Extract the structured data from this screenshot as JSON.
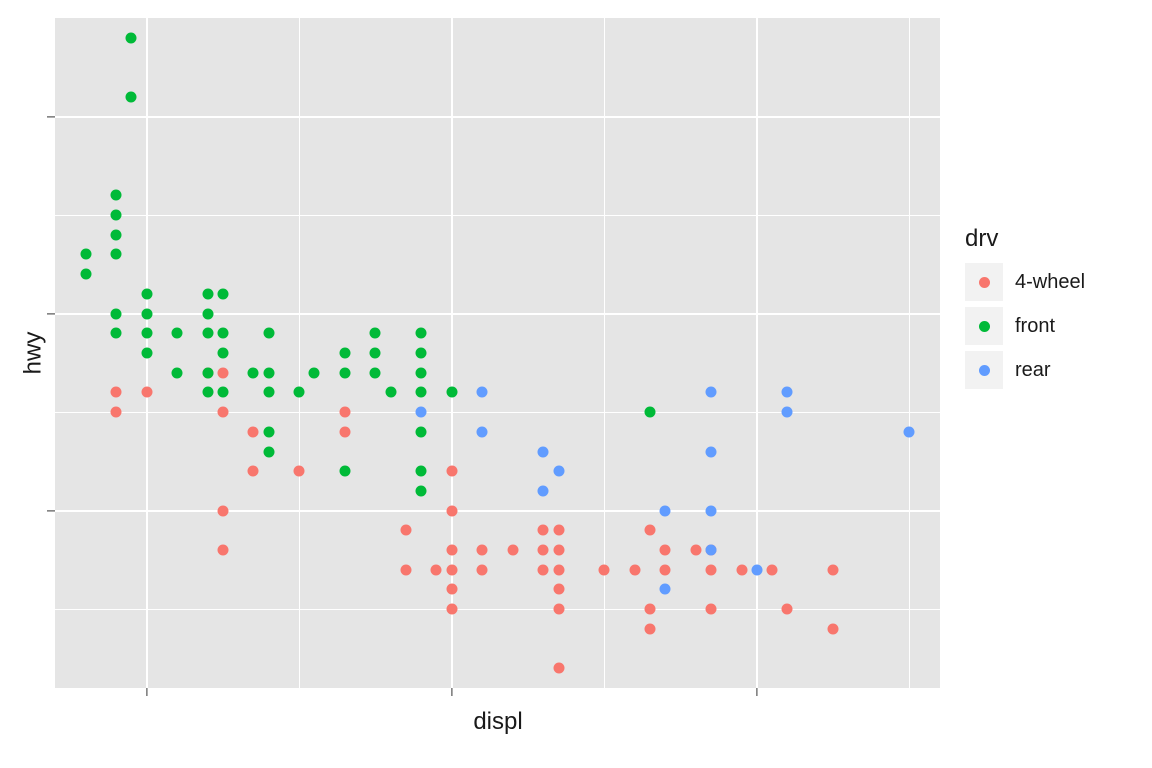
{
  "chart_data": {
    "type": "scatter",
    "xlabel": "displ",
    "ylabel": "hwy",
    "xlim": [
      1.4,
      7.2
    ],
    "ylim": [
      11,
      45
    ],
    "x_major_ticks": [
      2,
      4,
      6
    ],
    "x_minor_ticks": [
      3,
      5,
      7
    ],
    "y_major_ticks": [
      20,
      30,
      40
    ],
    "y_minor_ticks": [
      15,
      25,
      35
    ],
    "legend_title": "drv",
    "series": [
      {
        "name": "4-wheel",
        "color": "#F8766D",
        "points": [
          {
            "x": 1.8,
            "y": 26
          },
          {
            "x": 1.8,
            "y": 25
          },
          {
            "x": 2.0,
            "y": 26
          },
          {
            "x": 2.4,
            "y": 27
          },
          {
            "x": 2.5,
            "y": 25
          },
          {
            "x": 2.5,
            "y": 27
          },
          {
            "x": 2.5,
            "y": 20
          },
          {
            "x": 2.5,
            "y": 18
          },
          {
            "x": 2.7,
            "y": 24
          },
          {
            "x": 2.7,
            "y": 22
          },
          {
            "x": 3.0,
            "y": 22
          },
          {
            "x": 3.3,
            "y": 25
          },
          {
            "x": 3.3,
            "y": 24
          },
          {
            "x": 3.7,
            "y": 19
          },
          {
            "x": 3.7,
            "y": 17
          },
          {
            "x": 3.9,
            "y": 17
          },
          {
            "x": 4.0,
            "y": 20
          },
          {
            "x": 4.0,
            "y": 22
          },
          {
            "x": 4.0,
            "y": 18
          },
          {
            "x": 4.0,
            "y": 17
          },
          {
            "x": 4.0,
            "y": 15
          },
          {
            "x": 4.0,
            "y": 16
          },
          {
            "x": 4.2,
            "y": 17
          },
          {
            "x": 4.2,
            "y": 18
          },
          {
            "x": 4.4,
            "y": 18
          },
          {
            "x": 4.6,
            "y": 17
          },
          {
            "x": 4.6,
            "y": 19
          },
          {
            "x": 4.6,
            "y": 18
          },
          {
            "x": 4.7,
            "y": 17
          },
          {
            "x": 4.7,
            "y": 19
          },
          {
            "x": 4.7,
            "y": 12
          },
          {
            "x": 4.7,
            "y": 15
          },
          {
            "x": 4.7,
            "y": 16
          },
          {
            "x": 4.7,
            "y": 18
          },
          {
            "x": 5.0,
            "y": 17
          },
          {
            "x": 5.2,
            "y": 17
          },
          {
            "x": 5.3,
            "y": 19
          },
          {
            "x": 5.3,
            "y": 14
          },
          {
            "x": 5.3,
            "y": 15
          },
          {
            "x": 5.4,
            "y": 17
          },
          {
            "x": 5.4,
            "y": 18
          },
          {
            "x": 5.6,
            "y": 18
          },
          {
            "x": 5.7,
            "y": 17
          },
          {
            "x": 5.7,
            "y": 15
          },
          {
            "x": 5.7,
            "y": 18
          },
          {
            "x": 5.9,
            "y": 17
          },
          {
            "x": 6.1,
            "y": 17
          },
          {
            "x": 6.2,
            "y": 15
          },
          {
            "x": 6.5,
            "y": 17
          },
          {
            "x": 6.5,
            "y": 14
          }
        ]
      },
      {
        "name": "front",
        "color": "#00BA38",
        "points": [
          {
            "x": 1.6,
            "y": 33
          },
          {
            "x": 1.6,
            "y": 32
          },
          {
            "x": 1.8,
            "y": 29
          },
          {
            "x": 1.8,
            "y": 30
          },
          {
            "x": 1.8,
            "y": 36
          },
          {
            "x": 1.8,
            "y": 34
          },
          {
            "x": 1.8,
            "y": 35
          },
          {
            "x": 1.8,
            "y": 33
          },
          {
            "x": 1.9,
            "y": 44
          },
          {
            "x": 1.9,
            "y": 41
          },
          {
            "x": 2.0,
            "y": 30
          },
          {
            "x": 2.0,
            "y": 29
          },
          {
            "x": 2.0,
            "y": 31
          },
          {
            "x": 2.0,
            "y": 28
          },
          {
            "x": 2.2,
            "y": 27
          },
          {
            "x": 2.2,
            "y": 29
          },
          {
            "x": 2.4,
            "y": 30
          },
          {
            "x": 2.4,
            "y": 31
          },
          {
            "x": 2.4,
            "y": 29
          },
          {
            "x": 2.4,
            "y": 27
          },
          {
            "x": 2.4,
            "y": 26
          },
          {
            "x": 2.5,
            "y": 31
          },
          {
            "x": 2.5,
            "y": 29
          },
          {
            "x": 2.5,
            "y": 28
          },
          {
            "x": 2.5,
            "y": 26
          },
          {
            "x": 2.7,
            "y": 27
          },
          {
            "x": 2.8,
            "y": 26
          },
          {
            "x": 2.8,
            "y": 29
          },
          {
            "x": 2.8,
            "y": 27
          },
          {
            "x": 2.8,
            "y": 24
          },
          {
            "x": 2.8,
            "y": 23
          },
          {
            "x": 3.0,
            "y": 26
          },
          {
            "x": 3.1,
            "y": 27
          },
          {
            "x": 3.3,
            "y": 28
          },
          {
            "x": 3.3,
            "y": 27
          },
          {
            "x": 3.3,
            "y": 22
          },
          {
            "x": 3.5,
            "y": 29
          },
          {
            "x": 3.5,
            "y": 27
          },
          {
            "x": 3.5,
            "y": 28
          },
          {
            "x": 3.6,
            "y": 26
          },
          {
            "x": 3.8,
            "y": 26
          },
          {
            "x": 3.8,
            "y": 28
          },
          {
            "x": 3.8,
            "y": 29
          },
          {
            "x": 3.8,
            "y": 27
          },
          {
            "x": 3.8,
            "y": 24
          },
          {
            "x": 3.8,
            "y": 22
          },
          {
            "x": 3.8,
            "y": 21
          },
          {
            "x": 4.0,
            "y": 26
          },
          {
            "x": 5.3,
            "y": 25
          }
        ]
      },
      {
        "name": "rear",
        "color": "#619CFF",
        "points": [
          {
            "x": 3.8,
            "y": 25
          },
          {
            "x": 4.2,
            "y": 26
          },
          {
            "x": 4.2,
            "y": 24
          },
          {
            "x": 4.6,
            "y": 23
          },
          {
            "x": 4.6,
            "y": 21
          },
          {
            "x": 4.7,
            "y": 22
          },
          {
            "x": 5.4,
            "y": 20
          },
          {
            "x": 5.4,
            "y": 16
          },
          {
            "x": 5.7,
            "y": 26
          },
          {
            "x": 5.7,
            "y": 23
          },
          {
            "x": 5.7,
            "y": 20
          },
          {
            "x": 5.7,
            "y": 18
          },
          {
            "x": 6.0,
            "y": 17
          },
          {
            "x": 6.2,
            "y": 25
          },
          {
            "x": 6.2,
            "y": 26
          },
          {
            "x": 7.0,
            "y": 24
          }
        ]
      }
    ]
  }
}
